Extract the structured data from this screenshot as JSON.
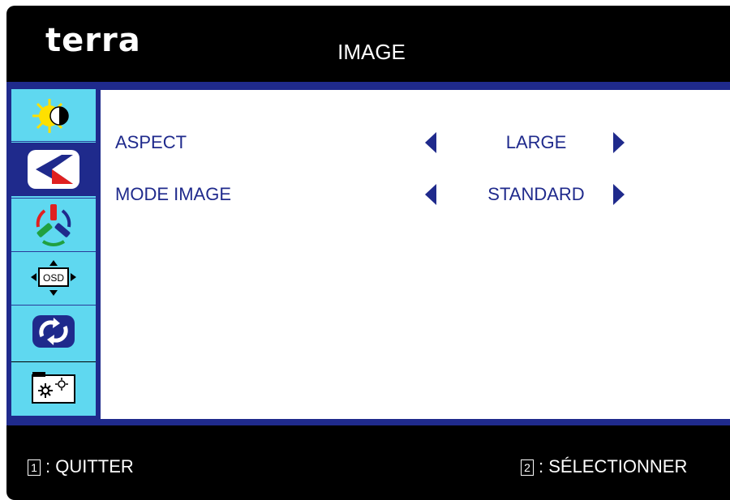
{
  "header": {
    "logo": "terra",
    "title": "IMAGE"
  },
  "sidebar": {
    "items": [
      {
        "icon": "brightness-contrast-icon"
      },
      {
        "icon": "image-icon",
        "selected": true
      },
      {
        "icon": "color-icon"
      },
      {
        "icon": "osd-settings-icon"
      },
      {
        "icon": "reset-icon"
      },
      {
        "icon": "extra-settings-icon"
      }
    ]
  },
  "menu": {
    "rows": [
      {
        "label": "ASPECT",
        "value": "LARGE"
      },
      {
        "label": "MODE IMAGE",
        "value": "STANDARD"
      }
    ]
  },
  "footer": {
    "left_key": "1",
    "left_label": ": QUITTER",
    "right_key": "2",
    "right_label": ": SÉLECTIONNER"
  },
  "colors": {
    "frame": "#1f2a8c",
    "sidebar": "#5fd8f0",
    "text": "#1f2a8c",
    "background": "#000000"
  }
}
